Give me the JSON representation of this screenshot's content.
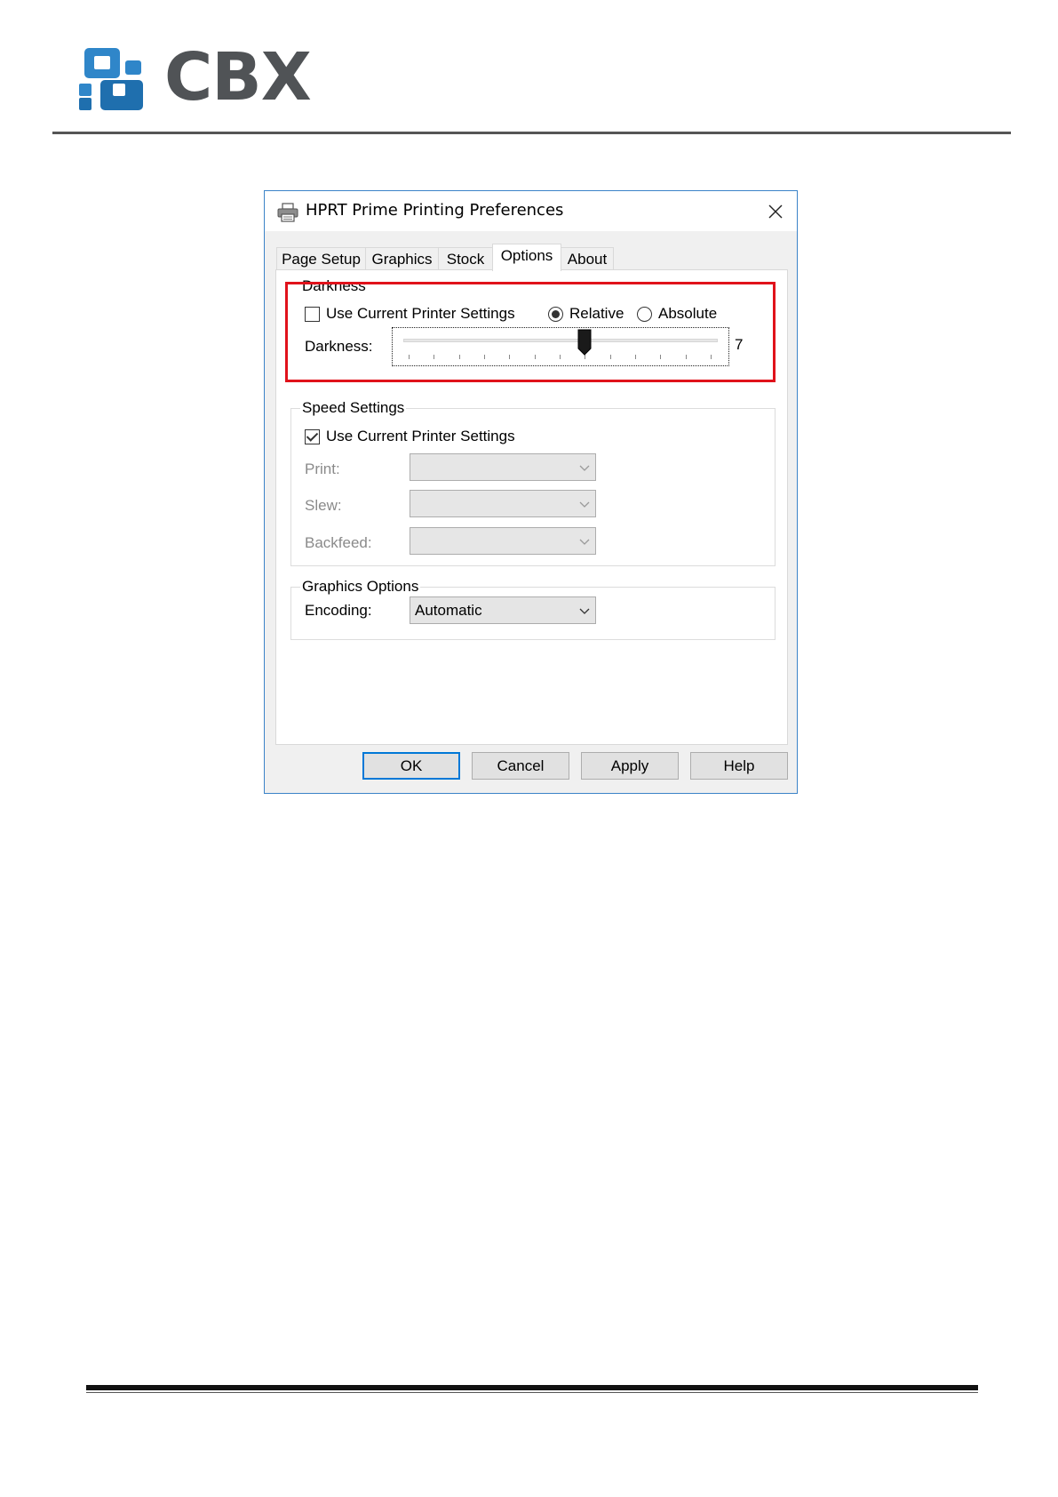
{
  "document": {
    "logo_text": "CBX"
  },
  "dialog": {
    "title": "HPRT Prime Printing Preferences",
    "icons": {
      "title": "printer-icon",
      "close": "close-icon"
    },
    "tabs": [
      {
        "label": "Page Setup"
      },
      {
        "label": "Graphics"
      },
      {
        "label": "Stock"
      },
      {
        "label": "Options",
        "active": true
      },
      {
        "label": "About"
      }
    ],
    "darkness_group": {
      "title": "Darkness",
      "use_current_label": "Use Current Printer Settings",
      "use_current_checked": false,
      "radio_relative_label": "Relative",
      "radio_absolute_label": "Absolute",
      "selected_mode": "Relative",
      "slider_label": "Darkness:",
      "slider_value": "7",
      "slider_min": 0,
      "slider_max": 12
    },
    "speed_group": {
      "title": "Speed Settings",
      "use_current_label": "Use Current Printer Settings",
      "use_current_checked": true,
      "print_label": "Print:",
      "slew_label": "Slew:",
      "backfeed_label": "Backfeed:",
      "print_value": "",
      "slew_value": "",
      "backfeed_value": ""
    },
    "graphics_group": {
      "title": "Graphics Options",
      "encoding_label": "Encoding:",
      "encoding_value": "Automatic"
    },
    "buttons": {
      "ok": "OK",
      "cancel": "Cancel",
      "apply": "Apply",
      "help": "Help"
    },
    "colors": {
      "highlight": "#e0121b",
      "accent": "#0078d7",
      "logo_blue": "#2f86c9"
    }
  }
}
